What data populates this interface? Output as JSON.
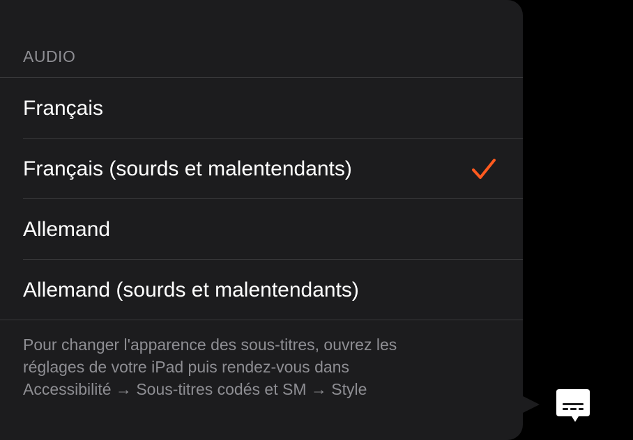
{
  "audio_menu": {
    "section_header": "AUDIO",
    "options": [
      {
        "label": "Français",
        "selected": false
      },
      {
        "label": "Français (sourds et malentendants)",
        "selected": true
      },
      {
        "label": "Allemand",
        "selected": false
      },
      {
        "label": "Allemand (sourds et malentendants)",
        "selected": false
      }
    ],
    "footnote_lines": [
      "Pour changer l'apparence des sous-titres, ouvrez les",
      "réglages de votre iPad puis rendez-vous dans",
      "Accessibilité → Sous-titres codés et SM → Style"
    ]
  },
  "controls": {
    "subtitles_button_icon": "subtitles-icon"
  },
  "colors": {
    "popover_bg": "#1c1c1e",
    "accent_check": "#ff5a1f",
    "secondary_text": "#8e8e93",
    "separator": "#3a3a3c"
  }
}
